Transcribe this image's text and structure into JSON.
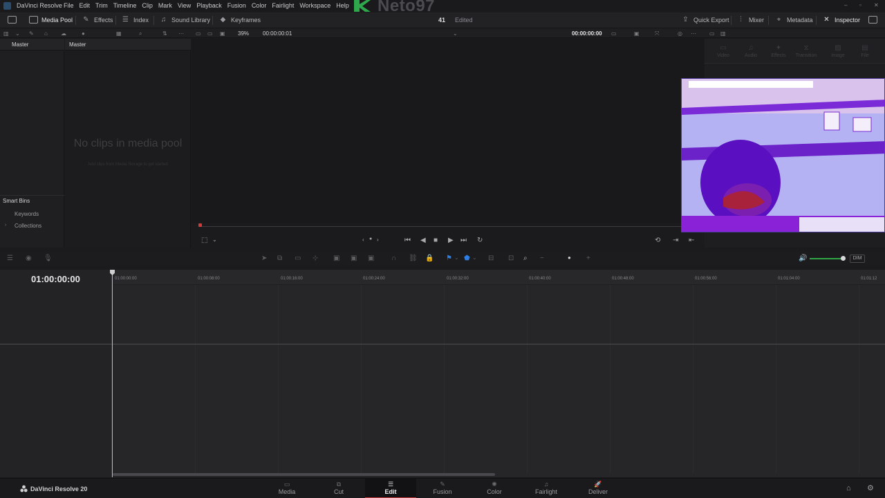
{
  "menubar": {
    "app_name": "DaVinci Resolve",
    "items": [
      "File",
      "Edit",
      "Trim",
      "Timeline",
      "Clip",
      "Mark",
      "View",
      "Playback",
      "Fusion",
      "Color",
      "Fairlight",
      "Workspace",
      "Help"
    ],
    "watermark": "Neto97"
  },
  "toolbar": {
    "media_pool": "Media Pool",
    "effects": "Effects",
    "index": "Index",
    "sound_library": "Sound Library",
    "keyframes": "Keyframes",
    "project_number": "41",
    "status": "Edited",
    "quick_export": "Quick Export",
    "mixer": "Mixer",
    "metadata": "Metadata",
    "inspector": "Inspector"
  },
  "subbar": {
    "zoom": "39%",
    "source_timecode": "00:00:00:01",
    "record_timecode": "00:00:00:00"
  },
  "bins": {
    "master": "Master",
    "smart_bins": "Smart Bins",
    "keywords": "Keywords",
    "collections": "Collections"
  },
  "pool": {
    "title": "Master",
    "empty_title": "No clips in media pool",
    "empty_hint": "Add clips from Media Storage to get started"
  },
  "inspector": {
    "tabs": [
      "Video",
      "Audio",
      "Effects",
      "Transition",
      "Image",
      "File"
    ]
  },
  "timeline": {
    "timecode": "01:00:00:00",
    "ruler": [
      "01:00:00:00",
      "01:00:08:00",
      "01:00:16:00",
      "01:00:24:00",
      "01:00:32:00",
      "01:00:40:00",
      "01:00:48:00",
      "01:00:56:00",
      "01:01:04:00",
      "01:01:12"
    ]
  },
  "audio": {
    "dim_label": "DIM",
    "volume_level": 0.9
  },
  "pagenav": {
    "brand": "DaVinci Resolve 20",
    "pages": [
      "Media",
      "Cut",
      "Edit",
      "Fusion",
      "Color",
      "Fairlight",
      "Deliver"
    ],
    "active_page": "Edit"
  },
  "colors": {
    "accent_red": "#c43b3b",
    "volume_green": "#2fa845",
    "watermark_green": "#2ea84a"
  }
}
